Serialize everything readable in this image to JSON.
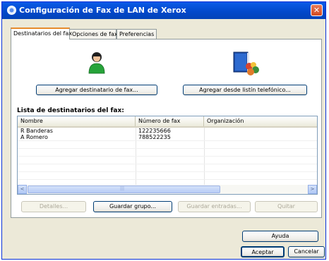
{
  "window": {
    "title": "Configuración de Fax de LAN de Xerox",
    "close_symbol": "✕"
  },
  "tabs": [
    {
      "label": "Destinatarios del fax",
      "active": true
    },
    {
      "label": "Opciones de fax",
      "active": false
    },
    {
      "label": "Preferencias",
      "active": false
    }
  ],
  "actions": {
    "add_recipient": "Agregar destinatario de fax...",
    "add_from_phonebook": "Agregar desde listín telefónico..."
  },
  "list": {
    "label": "Lista de destinatarios del fax:",
    "columns": [
      "Nombre",
      "Número de fax",
      "Organización"
    ],
    "rows": [
      {
        "name": "R Banderas",
        "fax": "122235666",
        "org": ""
      },
      {
        "name": "A Romero",
        "fax": "788522235",
        "org": ""
      }
    ],
    "scroll_left": "<",
    "scroll_right": ">",
    "thumb_grip": "|||"
  },
  "list_buttons": {
    "details": "Detalles...",
    "save_group": "Guardar grupo...",
    "save_entries": "Guardar entradas...",
    "remove": "Quitar"
  },
  "help": "Ayuda",
  "footer": {
    "ok": "Aceptar",
    "cancel": "Cancelar"
  },
  "colors": {
    "titlebar": "#0A5BE8",
    "dialog_bg": "#ECE9D8",
    "active_tab_accent": "#E68B2C",
    "close_button": "#D24A20"
  },
  "icons": {
    "title": "fax-app-icon",
    "add_recipient": "green-person-icon",
    "add_from_phonebook": "phonebook-people-icon"
  }
}
